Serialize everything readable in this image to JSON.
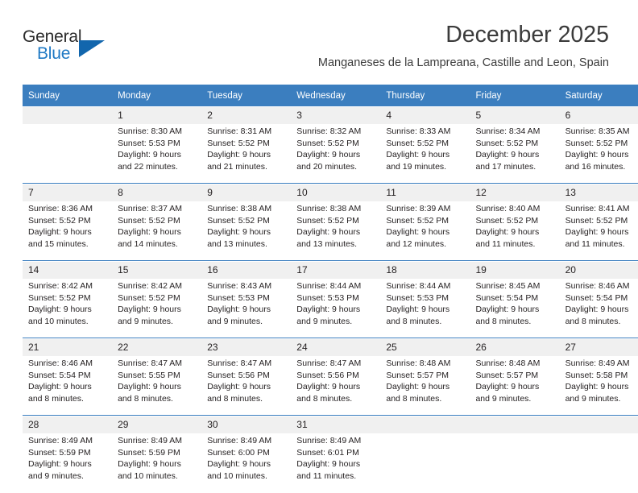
{
  "logo": {
    "word_one": "General",
    "word_two": "Blue",
    "triangle_icon": "triangle-icon",
    "brand_blue": "#1f79c4",
    "brand_dark": "#2b2b2b"
  },
  "header": {
    "title": "December 2025",
    "subtitle": "Manganeses de la Lampreana, Castille and Leon, Spain"
  },
  "calendar": {
    "header_bg": "#3b7ebf",
    "daynum_bg": "#f0f0f0",
    "weekdays": [
      "Sunday",
      "Monday",
      "Tuesday",
      "Wednesday",
      "Thursday",
      "Friday",
      "Saturday"
    ],
    "weeks": [
      [
        {
          "day": "",
          "lines": []
        },
        {
          "day": "1",
          "lines": [
            "Sunrise: 8:30 AM",
            "Sunset: 5:53 PM",
            "Daylight: 9 hours",
            "and 22 minutes."
          ]
        },
        {
          "day": "2",
          "lines": [
            "Sunrise: 8:31 AM",
            "Sunset: 5:52 PM",
            "Daylight: 9 hours",
            "and 21 minutes."
          ]
        },
        {
          "day": "3",
          "lines": [
            "Sunrise: 8:32 AM",
            "Sunset: 5:52 PM",
            "Daylight: 9 hours",
            "and 20 minutes."
          ]
        },
        {
          "day": "4",
          "lines": [
            "Sunrise: 8:33 AM",
            "Sunset: 5:52 PM",
            "Daylight: 9 hours",
            "and 19 minutes."
          ]
        },
        {
          "day": "5",
          "lines": [
            "Sunrise: 8:34 AM",
            "Sunset: 5:52 PM",
            "Daylight: 9 hours",
            "and 17 minutes."
          ]
        },
        {
          "day": "6",
          "lines": [
            "Sunrise: 8:35 AM",
            "Sunset: 5:52 PM",
            "Daylight: 9 hours",
            "and 16 minutes."
          ]
        }
      ],
      [
        {
          "day": "7",
          "lines": [
            "Sunrise: 8:36 AM",
            "Sunset: 5:52 PM",
            "Daylight: 9 hours",
            "and 15 minutes."
          ]
        },
        {
          "day": "8",
          "lines": [
            "Sunrise: 8:37 AM",
            "Sunset: 5:52 PM",
            "Daylight: 9 hours",
            "and 14 minutes."
          ]
        },
        {
          "day": "9",
          "lines": [
            "Sunrise: 8:38 AM",
            "Sunset: 5:52 PM",
            "Daylight: 9 hours",
            "and 13 minutes."
          ]
        },
        {
          "day": "10",
          "lines": [
            "Sunrise: 8:38 AM",
            "Sunset: 5:52 PM",
            "Daylight: 9 hours",
            "and 13 minutes."
          ]
        },
        {
          "day": "11",
          "lines": [
            "Sunrise: 8:39 AM",
            "Sunset: 5:52 PM",
            "Daylight: 9 hours",
            "and 12 minutes."
          ]
        },
        {
          "day": "12",
          "lines": [
            "Sunrise: 8:40 AM",
            "Sunset: 5:52 PM",
            "Daylight: 9 hours",
            "and 11 minutes."
          ]
        },
        {
          "day": "13",
          "lines": [
            "Sunrise: 8:41 AM",
            "Sunset: 5:52 PM",
            "Daylight: 9 hours",
            "and 11 minutes."
          ]
        }
      ],
      [
        {
          "day": "14",
          "lines": [
            "Sunrise: 8:42 AM",
            "Sunset: 5:52 PM",
            "Daylight: 9 hours",
            "and 10 minutes."
          ]
        },
        {
          "day": "15",
          "lines": [
            "Sunrise: 8:42 AM",
            "Sunset: 5:52 PM",
            "Daylight: 9 hours",
            "and 9 minutes."
          ]
        },
        {
          "day": "16",
          "lines": [
            "Sunrise: 8:43 AM",
            "Sunset: 5:53 PM",
            "Daylight: 9 hours",
            "and 9 minutes."
          ]
        },
        {
          "day": "17",
          "lines": [
            "Sunrise: 8:44 AM",
            "Sunset: 5:53 PM",
            "Daylight: 9 hours",
            "and 9 minutes."
          ]
        },
        {
          "day": "18",
          "lines": [
            "Sunrise: 8:44 AM",
            "Sunset: 5:53 PM",
            "Daylight: 9 hours",
            "and 8 minutes."
          ]
        },
        {
          "day": "19",
          "lines": [
            "Sunrise: 8:45 AM",
            "Sunset: 5:54 PM",
            "Daylight: 9 hours",
            "and 8 minutes."
          ]
        },
        {
          "day": "20",
          "lines": [
            "Sunrise: 8:46 AM",
            "Sunset: 5:54 PM",
            "Daylight: 9 hours",
            "and 8 minutes."
          ]
        }
      ],
      [
        {
          "day": "21",
          "lines": [
            "Sunrise: 8:46 AM",
            "Sunset: 5:54 PM",
            "Daylight: 9 hours",
            "and 8 minutes."
          ]
        },
        {
          "day": "22",
          "lines": [
            "Sunrise: 8:47 AM",
            "Sunset: 5:55 PM",
            "Daylight: 9 hours",
            "and 8 minutes."
          ]
        },
        {
          "day": "23",
          "lines": [
            "Sunrise: 8:47 AM",
            "Sunset: 5:56 PM",
            "Daylight: 9 hours",
            "and 8 minutes."
          ]
        },
        {
          "day": "24",
          "lines": [
            "Sunrise: 8:47 AM",
            "Sunset: 5:56 PM",
            "Daylight: 9 hours",
            "and 8 minutes."
          ]
        },
        {
          "day": "25",
          "lines": [
            "Sunrise: 8:48 AM",
            "Sunset: 5:57 PM",
            "Daylight: 9 hours",
            "and 8 minutes."
          ]
        },
        {
          "day": "26",
          "lines": [
            "Sunrise: 8:48 AM",
            "Sunset: 5:57 PM",
            "Daylight: 9 hours",
            "and 9 minutes."
          ]
        },
        {
          "day": "27",
          "lines": [
            "Sunrise: 8:49 AM",
            "Sunset: 5:58 PM",
            "Daylight: 9 hours",
            "and 9 minutes."
          ]
        }
      ],
      [
        {
          "day": "28",
          "lines": [
            "Sunrise: 8:49 AM",
            "Sunset: 5:59 PM",
            "Daylight: 9 hours",
            "and 9 minutes."
          ]
        },
        {
          "day": "29",
          "lines": [
            "Sunrise: 8:49 AM",
            "Sunset: 5:59 PM",
            "Daylight: 9 hours",
            "and 10 minutes."
          ]
        },
        {
          "day": "30",
          "lines": [
            "Sunrise: 8:49 AM",
            "Sunset: 6:00 PM",
            "Daylight: 9 hours",
            "and 10 minutes."
          ]
        },
        {
          "day": "31",
          "lines": [
            "Sunrise: 8:49 AM",
            "Sunset: 6:01 PM",
            "Daylight: 9 hours",
            "and 11 minutes."
          ]
        },
        {
          "day": "",
          "lines": []
        },
        {
          "day": "",
          "lines": []
        },
        {
          "day": "",
          "lines": []
        }
      ]
    ]
  }
}
